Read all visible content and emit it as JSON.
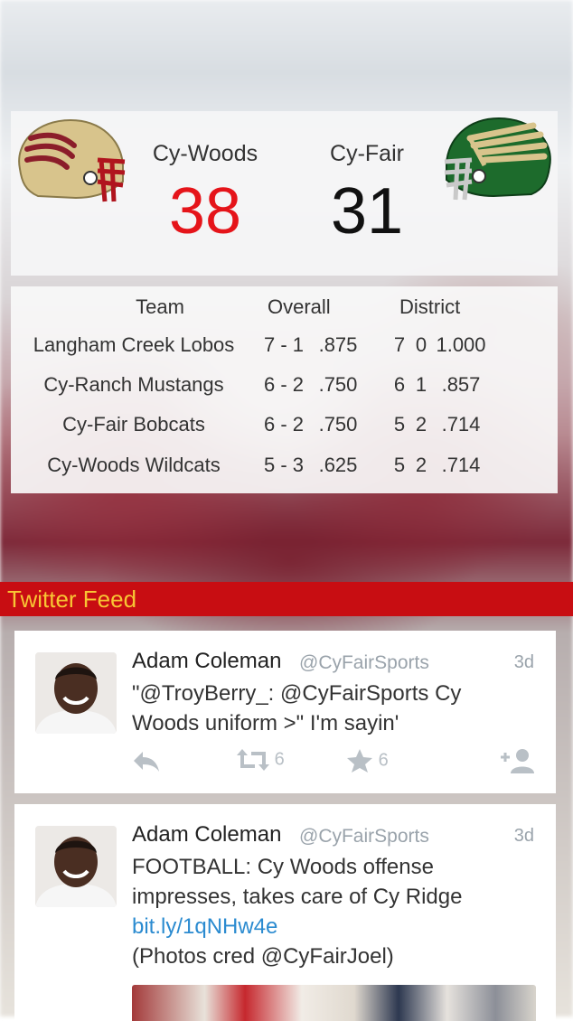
{
  "scoreboard": {
    "home": {
      "team": "Cy-Woods",
      "score": "38",
      "helmet_icon": "cy-woods-helmet-icon"
    },
    "away": {
      "team": "Cy-Fair",
      "score": "31",
      "helmet_icon": "cy-fair-helmet-icon"
    },
    "colors": {
      "home_score": "#e5141a",
      "away_score": "#111111"
    }
  },
  "standings": {
    "headers": {
      "team": "Team",
      "overall": "Overall",
      "district": "District"
    },
    "rows": [
      {
        "team": "Langham Creek Lobos",
        "overall_record": "7 - 1",
        "overall_pct": ".875",
        "district_w": "7",
        "district_l": "0",
        "district_pct": "1.000"
      },
      {
        "team": "Cy-Ranch Mustangs",
        "overall_record": "6 - 2",
        "overall_pct": ".750",
        "district_w": "6",
        "district_l": "1",
        "district_pct": ".857"
      },
      {
        "team": "Cy-Fair Bobcats",
        "overall_record": "6 - 2",
        "overall_pct": ".750",
        "district_w": "5",
        "district_l": "2",
        "district_pct": ".714"
      },
      {
        "team": "Cy-Woods Wildcats",
        "overall_record": "5 - 3",
        "overall_pct": ".625",
        "district_w": "5",
        "district_l": "2",
        "district_pct": ".714"
      }
    ]
  },
  "feed": {
    "title": "Twitter Feed",
    "bar_color": "#c80d12",
    "title_color": "#f8c534"
  },
  "tweets": [
    {
      "name": "Adam Coleman",
      "handle": "@CyFairSports",
      "time": "3d",
      "line1": "\"@TroyBerry_: @CyFairSports Cy",
      "line2": "Woods uniform >\" I'm sayin'",
      "retweets": "6",
      "favorites": "6"
    },
    {
      "name": "Adam Coleman",
      "handle": "@CyFairSports",
      "time": "3d",
      "line1": "FOOTBALL: Cy Woods offense",
      "line2": "impresses, takes care of Cy Ridge",
      "link": "bit.ly/1qNHw4e",
      "line4": "(Photos cred @CyFairJoel)"
    }
  ],
  "icons": [
    "reply-icon",
    "retweet-icon",
    "star-icon",
    "follow-icon"
  ]
}
